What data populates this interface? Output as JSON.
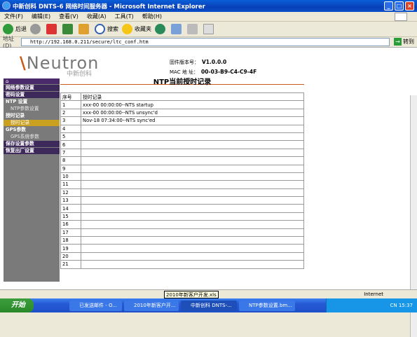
{
  "window": {
    "title": "中新创科 DNTS-6 网络时间服务器 - Microsoft Internet Explorer",
    "min": "_",
    "max": "□",
    "close": "×"
  },
  "menu": [
    "文件(F)",
    "编辑(E)",
    "查看(V)",
    "收藏(A)",
    "工具(T)",
    "帮助(H)"
  ],
  "toolbar": {
    "back": "后退",
    "search": "搜索",
    "favorites": "收藏夹"
  },
  "address": {
    "label": "地址(D)",
    "url": "http://192.168.0.211/secure/ltc_conf.htm",
    "go": "转到"
  },
  "header": {
    "logo": "Neutron",
    "logo_cn": "中新创科",
    "firmware_label": "固件版本号",
    "firmware": "V1.0.0.0",
    "mac_label": "MAC 地 址",
    "mac": "00-03-B9-C4-C9-4F"
  },
  "sidebar": {
    "home": "⌂",
    "items": [
      {
        "label": "网络参数设置",
        "type": "head"
      },
      {
        "label": "密码设置",
        "type": "head"
      },
      {
        "label": "NTP 设置",
        "type": "plain"
      },
      {
        "label": "NTP参数设置",
        "type": "sub"
      },
      {
        "label": "授时记录",
        "type": "plain"
      },
      {
        "label": "授时记录",
        "type": "active"
      },
      {
        "label": "GPS参数",
        "type": "plain"
      },
      {
        "label": "GPS系统参数",
        "type": "sub"
      },
      {
        "label": "保存设置参数",
        "type": "head"
      },
      {
        "label": "恢复出厂设置",
        "type": "head"
      }
    ]
  },
  "main": {
    "title": "NTP当前授时记录",
    "columns": [
      "序号",
      "授时记录"
    ],
    "rows": [
      [
        "1",
        "xxx-00 00:00:00--NTS startup"
      ],
      [
        "2",
        "xxx-00 00:00:00--NTS unsync'd"
      ],
      [
        "3",
        "Nov-18 07:34:00--NTS sync'ed"
      ],
      [
        "4",
        ""
      ],
      [
        "5",
        ""
      ],
      [
        "6",
        ""
      ],
      [
        "7",
        ""
      ],
      [
        "8",
        ""
      ],
      [
        "9",
        ""
      ],
      [
        "10",
        ""
      ],
      [
        "11",
        ""
      ],
      [
        "12",
        ""
      ],
      [
        "13",
        ""
      ],
      [
        "14",
        ""
      ],
      [
        "15",
        ""
      ],
      [
        "16",
        ""
      ],
      [
        "17",
        ""
      ],
      [
        "18",
        ""
      ],
      [
        "19",
        ""
      ],
      [
        "20",
        ""
      ],
      [
        "21",
        ""
      ]
    ]
  },
  "status": {
    "tooltip": "2010年新客户开发.xls",
    "zone": "Internet"
  },
  "taskbar": {
    "start": "开始",
    "tasks": [
      "已发送邮件 - O...",
      "2010年新客户开...",
      "中新创科 DNTS-...",
      "NTP参数设置.bm..."
    ],
    "clock": "CN  15:37"
  }
}
